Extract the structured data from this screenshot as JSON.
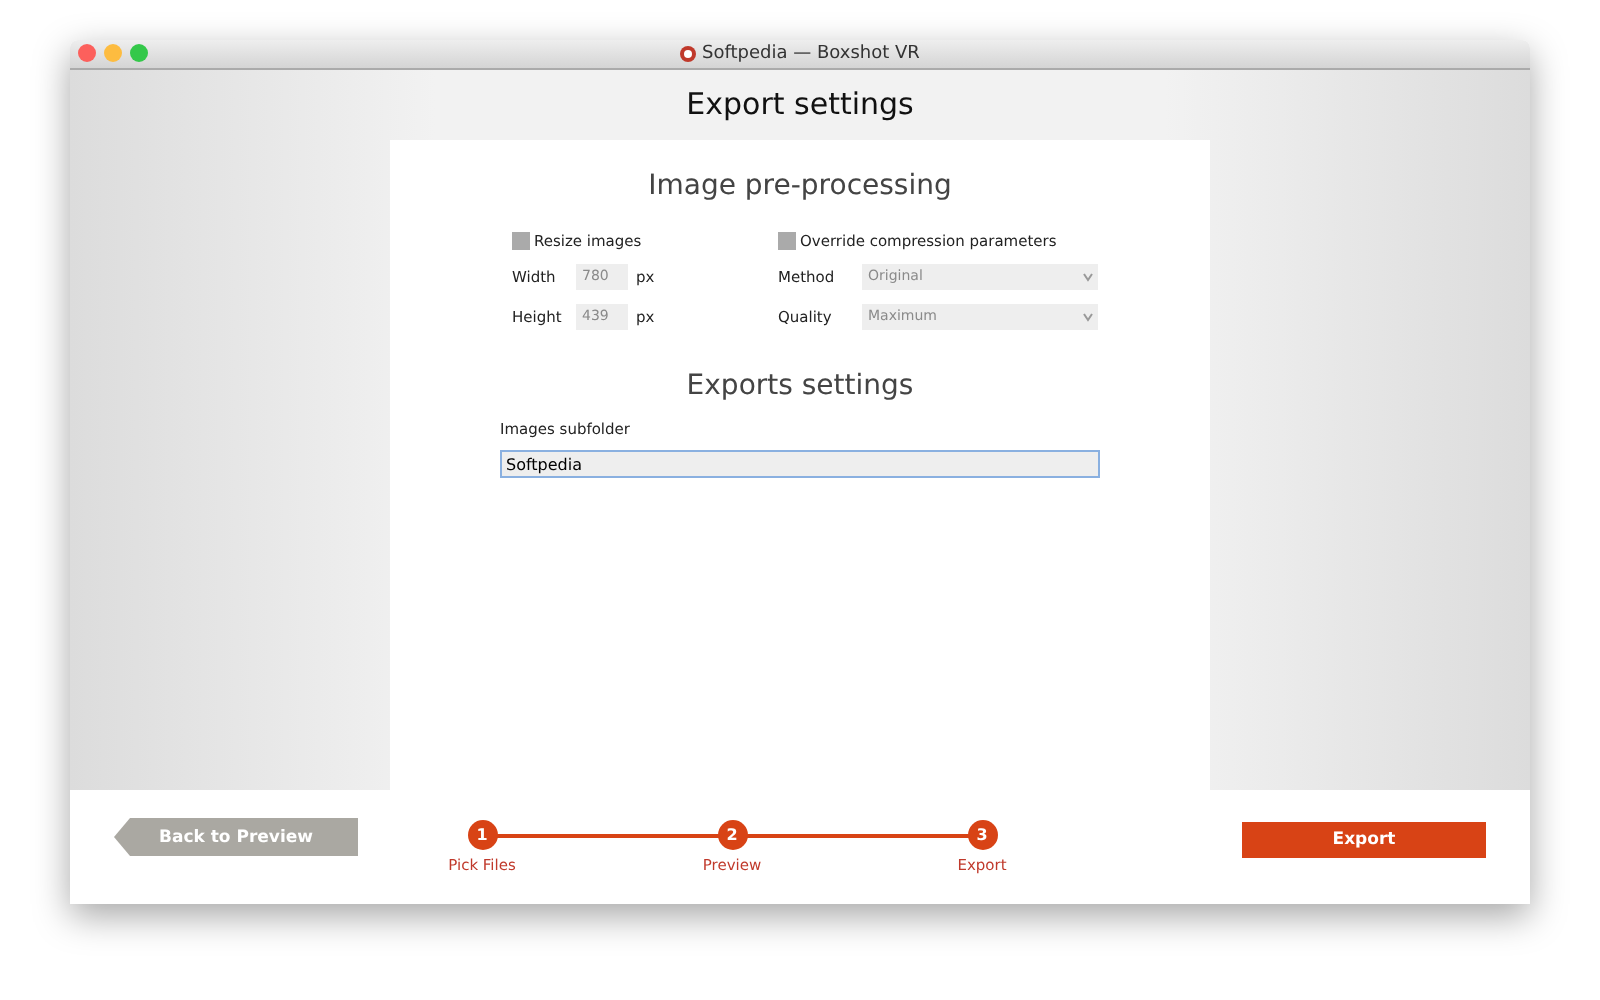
{
  "window": {
    "title": "Softpedia — Boxshot VR"
  },
  "heading": "Export settings",
  "preprocessing": {
    "title": "Image pre-processing",
    "resize": {
      "label": "Resize images",
      "checked": false
    },
    "width": {
      "label": "Width",
      "value": "780",
      "unit": "px",
      "disabled": true
    },
    "height": {
      "label": "Height",
      "value": "439",
      "unit": "px",
      "disabled": true
    },
    "override": {
      "label": "Override compression parameters",
      "checked": false
    },
    "method": {
      "label": "Method",
      "value": "Original",
      "disabled": true
    },
    "quality": {
      "label": "Quality",
      "value": "Maximum",
      "disabled": true
    }
  },
  "exports": {
    "title": "Exports settings",
    "subfolder_label": "Images subfolder",
    "subfolder_value": "Softpedia"
  },
  "footer": {
    "back": "Back to Preview",
    "export": "Export",
    "steps": [
      {
        "number": "1",
        "label": "Pick Files"
      },
      {
        "number": "2",
        "label": "Preview"
      },
      {
        "number": "3",
        "label": "Export"
      }
    ]
  }
}
